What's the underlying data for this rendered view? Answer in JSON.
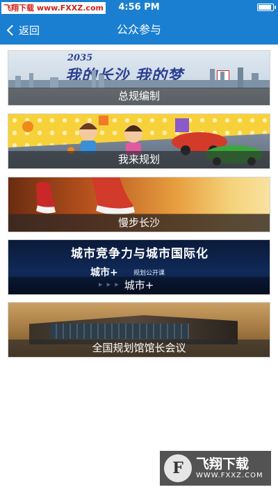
{
  "status_bar": {
    "time": "4:56 PM",
    "watermark": "飞翔下载 www.FXXZ.com",
    "battery_level_percent": 90
  },
  "nav": {
    "back_label": "返回",
    "title": "公众参与"
  },
  "banners": [
    {
      "caption": "总规编制",
      "year_text": "2035",
      "slogan": "我的长沙 我的梦"
    },
    {
      "caption": "我来规划"
    },
    {
      "caption": "慢步长沙"
    },
    {
      "caption": "城市+",
      "headline": "城市竞争力与城市国际化",
      "logo_text": "城市+",
      "course_text": "规划公开课"
    },
    {
      "caption": "全国规划馆馆长会议"
    }
  ],
  "watermark_logo": {
    "text_cn": "飞翔下载",
    "url": "WWW.FXXZ.COM"
  }
}
